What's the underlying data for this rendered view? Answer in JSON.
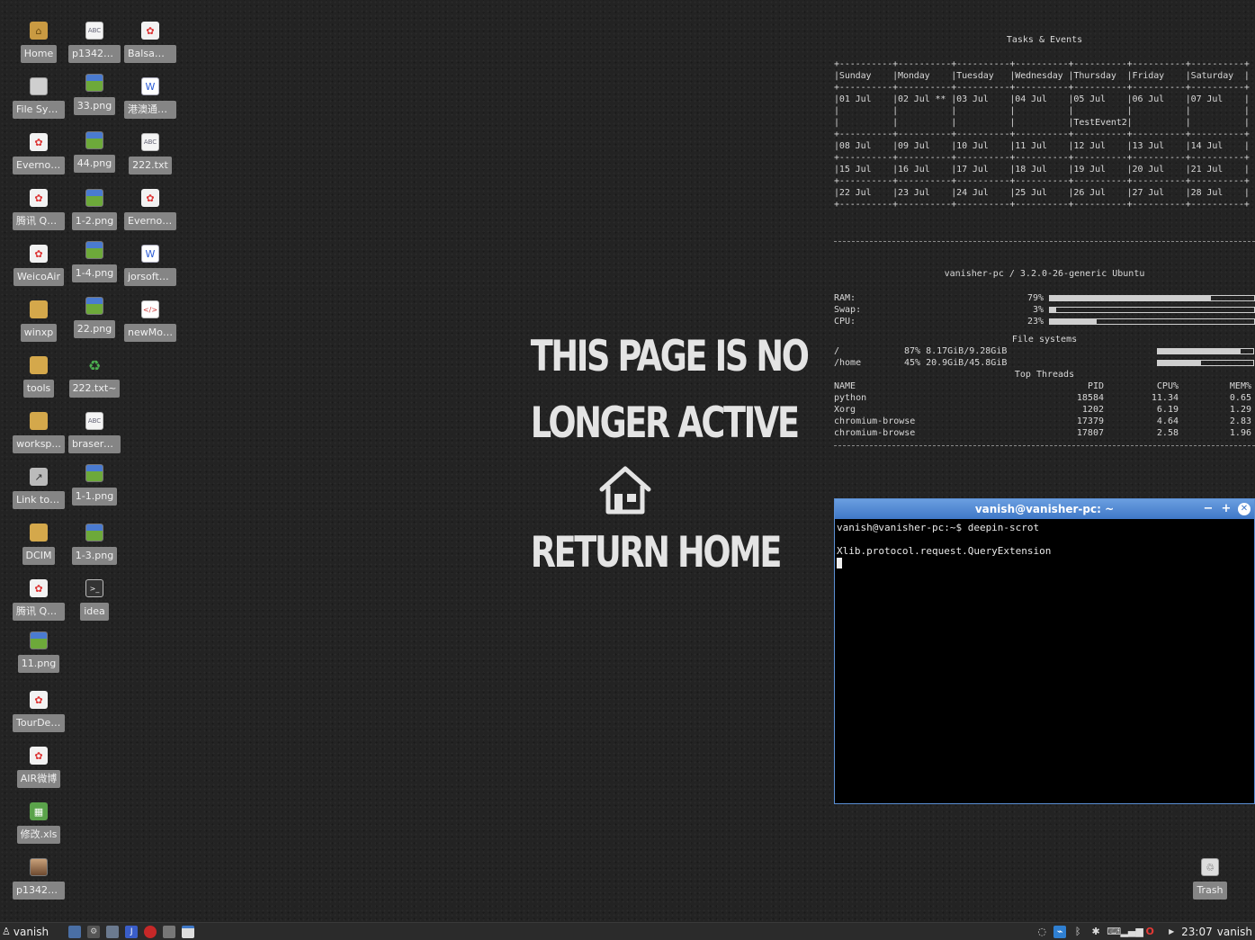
{
  "desktop": {
    "icons": [
      {
        "label": "Home",
        "icon": "home-folder-icon"
      },
      {
        "label": "File Sys...",
        "icon": "drive-icon"
      },
      {
        "label": "Evernot...",
        "icon": "app-icon"
      },
      {
        "label": "腾讯 Q+...",
        "icon": "app-icon"
      },
      {
        "label": "WeicoAir",
        "icon": "app-icon"
      },
      {
        "label": "winxp",
        "icon": "folder-icon"
      },
      {
        "label": "tools",
        "icon": "folder-icon"
      },
      {
        "label": "worksp...",
        "icon": "folder-icon"
      },
      {
        "label": "Link to ...",
        "icon": "link-icon"
      },
      {
        "label": "DCIM",
        "icon": "folder-icon"
      },
      {
        "label": "腾讯 Q+...",
        "icon": "app-icon"
      },
      {
        "label": "11.png",
        "icon": "image-icon"
      },
      {
        "label": "TourDeF...",
        "icon": "app-icon"
      },
      {
        "label": "AIR微博",
        "icon": "app-icon"
      },
      {
        "label": "修改.xls",
        "icon": "spreadsheet-icon"
      },
      {
        "label": "p13425...",
        "icon": "photo-icon"
      },
      {
        "label": "p13425...",
        "icon": "text-file-icon"
      },
      {
        "label": "33.png",
        "icon": "image-icon"
      },
      {
        "label": "44.png",
        "icon": "image-icon"
      },
      {
        "label": "1-2.png",
        "icon": "image-icon"
      },
      {
        "label": "1-4.png",
        "icon": "image-icon"
      },
      {
        "label": "22.png",
        "icon": "image-icon"
      },
      {
        "label": "222.txt~",
        "icon": "recycle-icon"
      },
      {
        "label": "brasero...",
        "icon": "text-file-icon"
      },
      {
        "label": "1-1.png",
        "icon": "image-icon"
      },
      {
        "label": "1-3.png",
        "icon": "image-icon"
      },
      {
        "label": "idea",
        "icon": "terminal-icon"
      },
      {
        "label": "Balsami...",
        "icon": "app-icon"
      },
      {
        "label": "港澳通行...",
        "icon": "document-icon"
      },
      {
        "label": "222.txt",
        "icon": "text-file-icon"
      },
      {
        "label": "Evernot...",
        "icon": "app-icon"
      },
      {
        "label": "jorsoftcl...",
        "icon": "document-icon"
      },
      {
        "label": "newMoc...",
        "icon": "code-file-icon"
      },
      {
        "label": "Trash",
        "icon": "trash-icon"
      }
    ]
  },
  "banner": {
    "line1": "THIS PAGE IS NO",
    "line2": "LONGER ACTIVE",
    "line3": "RETURN HOME"
  },
  "conky": {
    "calendar_title": "Tasks & Events",
    "calendar_text": "+----------+----------+----------+----------+----------+----------+----------+\n|Sunday    |Monday    |Tuesday   |Wednesday |Thursday  |Friday    |Saturday  |\n+----------+----------+----------+----------+----------+----------+----------+\n|01 Jul    |02 Jul ** |03 Jul    |04 Jul    |05 Jul    |06 Jul    |07 Jul    |\n|          |          |          |          |          |          |          |\n|          |          |          |          |TestEvent2|          |          |\n+----------+----------+----------+----------+----------+----------+----------+\n|08 Jul    |09 Jul    |10 Jul    |11 Jul    |12 Jul    |13 Jul    |14 Jul    |\n+----------+----------+----------+----------+----------+----------+----------+\n|15 Jul    |16 Jul    |17 Jul    |18 Jul    |19 Jul    |20 Jul    |21 Jul    |\n+----------+----------+----------+----------+----------+----------+----------+\n|22 Jul    |23 Jul    |24 Jul    |25 Jul    |26 Jul    |27 Jul    |28 Jul    |\n+----------+----------+----------+----------+----------+----------+----------+",
    "system_title": "vanisher-pc / 3.2.0-26-generic Ubuntu",
    "ram": {
      "label": "RAM:",
      "value": "79%",
      "level": 0.79
    },
    "swap": {
      "label": "Swap:",
      "value": "3%",
      "level": 0.03
    },
    "cpu": {
      "label": "CPU:",
      "value": "23%",
      "level": 0.23
    },
    "fs_title": "File systems",
    "fs": [
      {
        "mount": "/",
        "pct": "87%",
        "usage": "8.17GiB/9.28GiB",
        "level": 0.87
      },
      {
        "mount": "/home",
        "pct": "45%",
        "usage": "20.9GiB/45.8GiB",
        "level": 0.45
      }
    ],
    "threads_title": "Top Threads",
    "threads_headers": {
      "name": "NAME",
      "pid": "PID",
      "cpu": "CPU%",
      "mem": "MEM%"
    },
    "threads": [
      {
        "name": "python",
        "pid": "18584",
        "cpu": "11.34",
        "mem": "0.65"
      },
      {
        "name": "Xorg",
        "pid": "1202",
        "cpu": "6.19",
        "mem": "1.29"
      },
      {
        "name": "chromium-browse",
        "pid": "17379",
        "cpu": "4.64",
        "mem": "2.83"
      },
      {
        "name": "chromium-browse",
        "pid": "17807",
        "cpu": "2.58",
        "mem": "1.96"
      }
    ]
  },
  "terminal": {
    "title": "vanish@vanisher-pc: ~",
    "line1": "vanish@vanisher-pc:~$  deepin-scrot",
    "line2": "Xlib.protocol.request.QueryExtension"
  },
  "taskbar": {
    "user": "vanish",
    "clock": "23:07",
    "clock_user": "vanish"
  }
}
